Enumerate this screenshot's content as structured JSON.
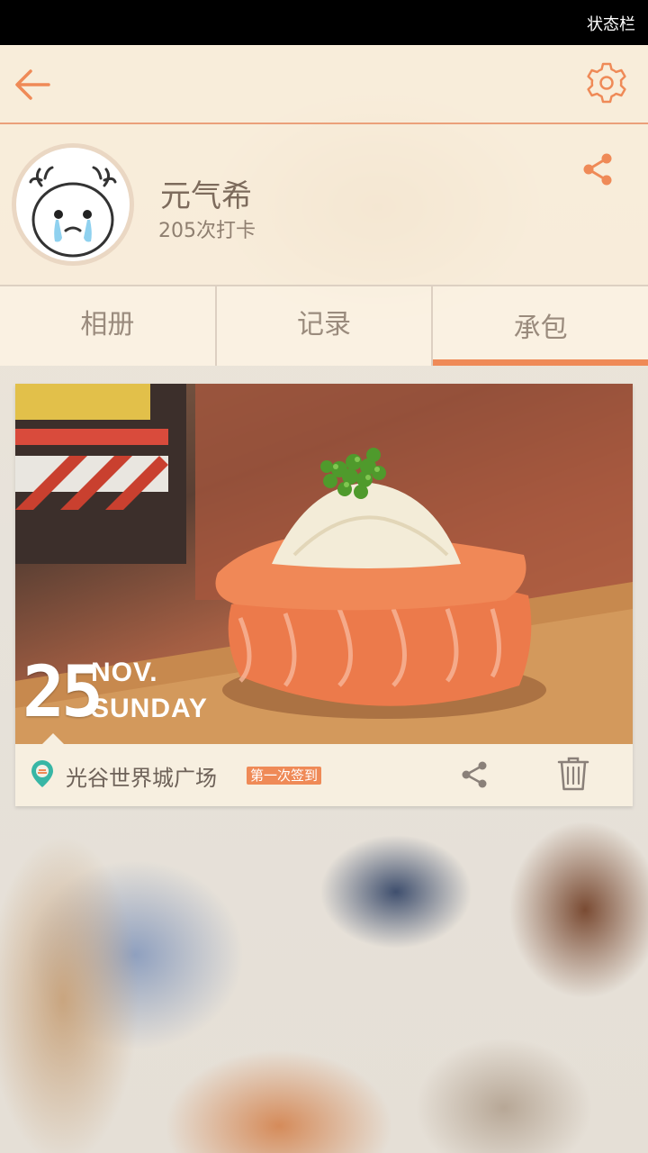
{
  "status_bar": {
    "text": "状态栏"
  },
  "header": {
    "back_icon": "arrow-left-icon",
    "settings_icon": "gear-icon"
  },
  "profile": {
    "name": "元气希",
    "checkins": "205次打卡",
    "share_icon": "share-icon"
  },
  "tabs": [
    {
      "label": "相册",
      "active": false
    },
    {
      "label": "记录",
      "active": false
    },
    {
      "label": "承包",
      "active": true
    }
  ],
  "card": {
    "date": {
      "day": "25",
      "month": "NOV.",
      "weekday": "SUNDAY"
    },
    "location": "光谷世界城广场",
    "badge": "第一次签到",
    "icons": [
      "map-pin-icon",
      "share-icon",
      "trash-icon"
    ]
  },
  "colors": {
    "accent": "#ef8a57",
    "text_muted": "#9a8b7d"
  }
}
